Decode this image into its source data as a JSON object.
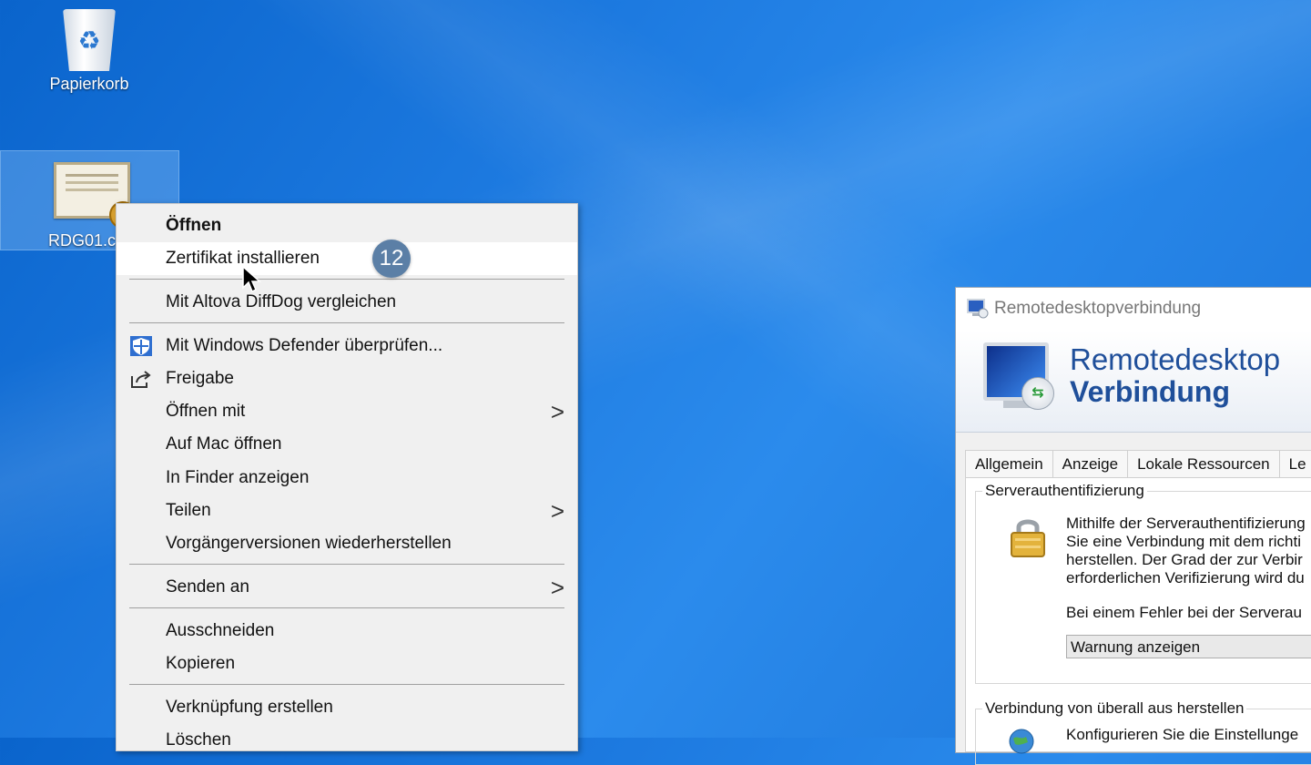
{
  "desktop": {
    "icons": [
      {
        "label": "Papierkorb"
      },
      {
        "label": "RDG01.c"
      }
    ]
  },
  "context_menu": {
    "items": [
      {
        "label": "Öffnen"
      },
      {
        "label": "Zertifikat installieren"
      },
      {
        "label": "Mit Altova DiffDog vergleichen"
      },
      {
        "label": "Mit Windows Defender überprüfen..."
      },
      {
        "label": "Freigabe"
      },
      {
        "label": "Öffnen mit"
      },
      {
        "label": "Auf Mac öffnen"
      },
      {
        "label": "In Finder anzeigen"
      },
      {
        "label": "Teilen"
      },
      {
        "label": "Vorgängerversionen wiederherstellen"
      },
      {
        "label": "Senden an"
      },
      {
        "label": "Ausschneiden"
      },
      {
        "label": "Kopieren"
      },
      {
        "label": "Verknüpfung erstellen"
      },
      {
        "label": "Löschen"
      }
    ],
    "submenu_arrow": ">"
  },
  "step_badge": "12",
  "rdp_window": {
    "title": "Remotedesktopverbindung",
    "banner_line1": "Remotedesktop",
    "banner_line2": "Verbindung",
    "tabs": [
      "Allgemein",
      "Anzeige",
      "Lokale Ressourcen",
      "Le"
    ],
    "server_auth": {
      "group_title": "Serverauthentifizierung",
      "description": [
        "Mithilfe der Serverauthentifizierung",
        "Sie eine Verbindung mit dem richti",
        "herstellen. Der Grad der zur Verbir",
        "erforderlichen Verifizierung wird du"
      ],
      "error_label": "Bei einem Fehler bei der Serverau",
      "select_value": "Warnung anzeigen"
    },
    "anywhere": {
      "group_title": "Verbindung von überall aus herstellen",
      "description": "Konfigurieren Sie die Einstellunge"
    }
  }
}
